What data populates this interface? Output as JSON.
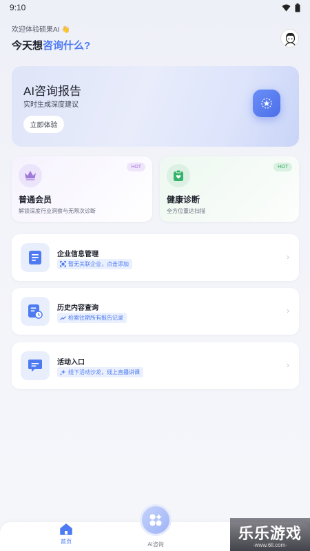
{
  "status_bar": {
    "time": "9:10"
  },
  "greeting": "欢迎体验硕果AI 👋",
  "headline": {
    "prefix": "今天想",
    "accent": "咨询什么?"
  },
  "hero": {
    "title": "AI咨询报告",
    "subtitle": "实时生成深度建议",
    "button": "立即体验"
  },
  "features": [
    {
      "title": "普通会员",
      "desc": "解锁深度行业洞察与无限次诊断",
      "badge": "HOT",
      "icon": "crown-icon"
    },
    {
      "title": "健康诊断",
      "desc": "全方位重达扫描",
      "badge": "HOT",
      "icon": "clipboard-heart-icon"
    }
  ],
  "list": [
    {
      "title": "企业信息管理",
      "tag": "暂无关联企业，点击添加",
      "icon": "document-icon",
      "tag_icon": "scan-icon"
    },
    {
      "title": "历史内容查询",
      "tag": "检索往期所有报告记录",
      "icon": "history-doc-icon",
      "tag_icon": "trend-icon"
    },
    {
      "title": "活动入口",
      "tag": "线下活动沙龙，线上直播讲课",
      "icon": "chat-icon",
      "tag_icon": "sparkle-icon"
    }
  ],
  "bottom_nav": {
    "home": "首页",
    "ai": "AI咨询"
  },
  "watermark": {
    "big": "乐乐游戏",
    "small": "-www.6ll.com-"
  },
  "colors": {
    "accent": "#4e7bf2",
    "member_badge": "#a27ad8",
    "health_badge": "#3fa86a"
  }
}
